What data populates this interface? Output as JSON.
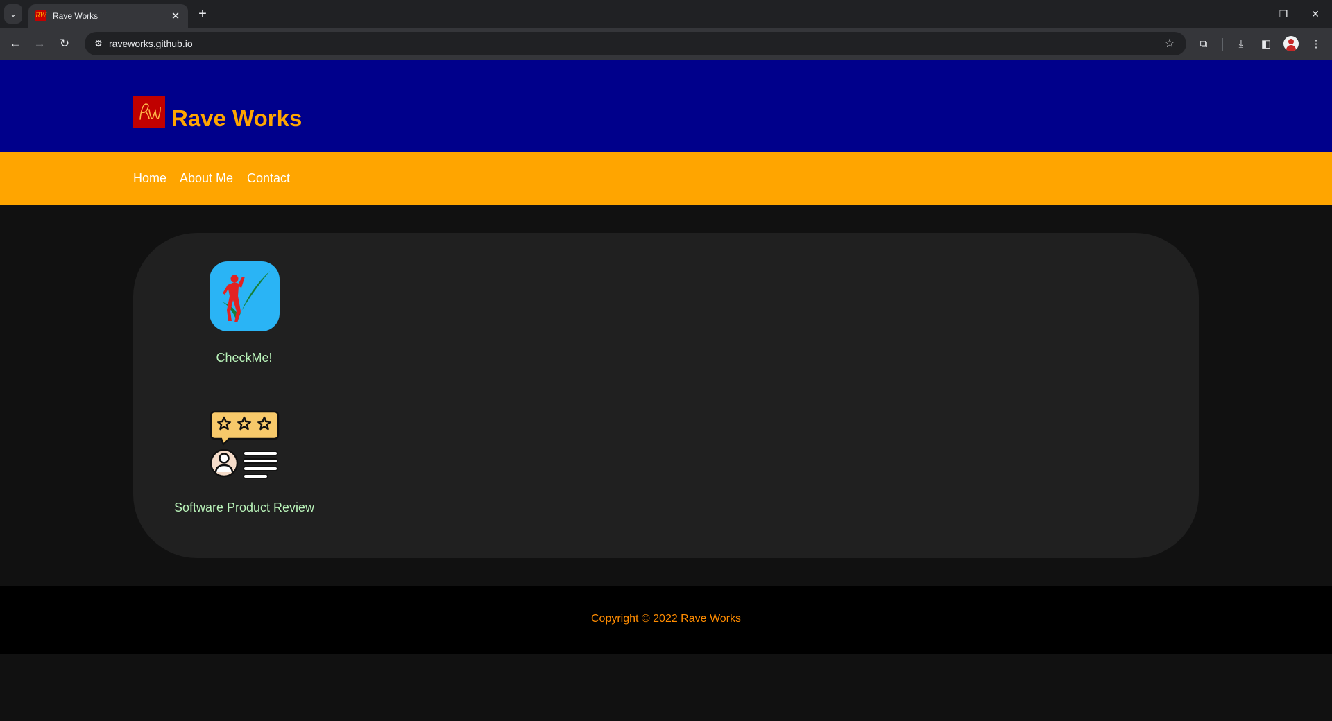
{
  "browser": {
    "tab_title": "Rave Works",
    "url": "raveworks.github.io",
    "tab_list_icon": "chevron-down-icon",
    "new_tab_icon": "plus-icon",
    "favicon_text": "RW"
  },
  "header": {
    "brand": "Rave Works",
    "logo_text": "RW",
    "colors": {
      "background": "#00008b",
      "brand": "#ffa500",
      "logo_bg": "#c00000"
    }
  },
  "nav": {
    "items": [
      {
        "label": "Home"
      },
      {
        "label": "About Me"
      },
      {
        "label": "Contact"
      }
    ],
    "colors": {
      "background": "#ffa500",
      "text": "#ffffff"
    }
  },
  "apps": [
    {
      "label": "CheckMe!",
      "icon": "checkme-app-icon"
    },
    {
      "label": "Software Product Review",
      "icon": "product-review-icon"
    }
  ],
  "footer": {
    "copyright": "Copyright © 2022 Rave Works",
    "colors": {
      "text": "#ff8c00",
      "background": "#000000"
    }
  }
}
